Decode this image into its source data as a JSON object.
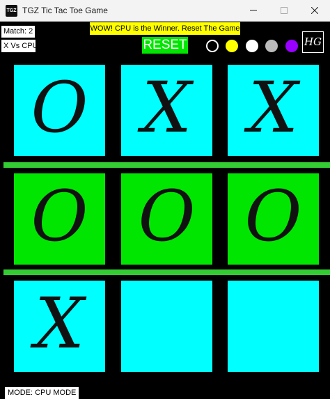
{
  "window": {
    "title": "TGZ Tic Tac Toe Game",
    "icon_text": "TGZ"
  },
  "header": {
    "match_label": "Match:  2",
    "players_label": "X Vs CPU",
    "status_message": "WOW! CPU is the Winner. Reset The Game",
    "reset_label": "RESET",
    "logo_text": "HG",
    "swatches": [
      {
        "name": "black",
        "color": "#000000"
      },
      {
        "name": "yellow",
        "color": "#ffff00"
      },
      {
        "name": "white",
        "color": "#ffffff"
      },
      {
        "name": "gray",
        "color": "#bbbbbb"
      },
      {
        "name": "purple",
        "color": "#9900ff"
      }
    ]
  },
  "colors": {
    "cell_default": "#00ffff",
    "cell_win": "#00e600",
    "divider": "#33cc33"
  },
  "board": {
    "cells": [
      {
        "mark": "O",
        "winning": false
      },
      {
        "mark": "X",
        "winning": false
      },
      {
        "mark": "X",
        "winning": false
      },
      {
        "mark": "O",
        "winning": true
      },
      {
        "mark": "O",
        "winning": true
      },
      {
        "mark": "O",
        "winning": true
      },
      {
        "mark": "X",
        "winning": false
      },
      {
        "mark": "",
        "winning": false
      },
      {
        "mark": "",
        "winning": false
      }
    ]
  },
  "footer": {
    "mode_label": "MODE: CPU MODE"
  }
}
